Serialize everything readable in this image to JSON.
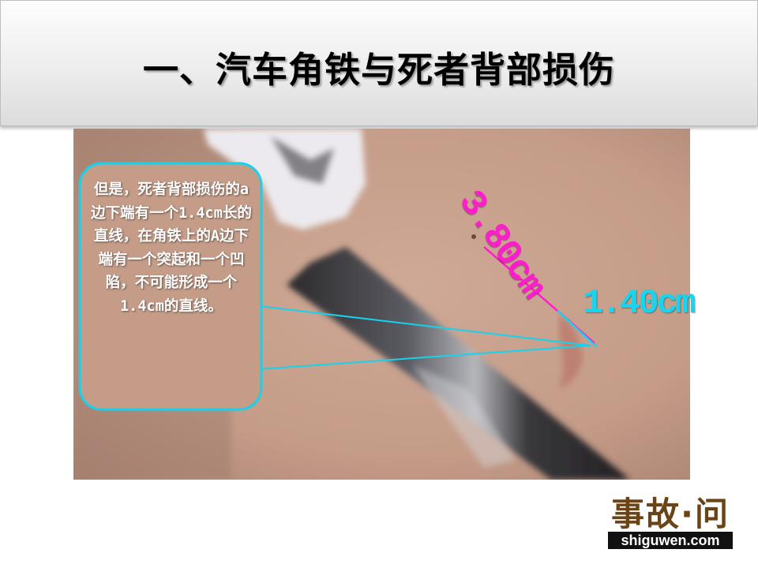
{
  "slide": {
    "title": "一、汽车角铁与死者背部损伤"
  },
  "callout": {
    "text": "但是，死者背部损伤的a边下端有一个1.4cm长的直线，在角铁上的A边下端有一个突起和一个凹陷，不可能形成一个1.4cm的直线。"
  },
  "measurements": {
    "long_edge": "3.80cm",
    "short_edge": "1.40cm"
  },
  "logo": {
    "chinese": "事故·问",
    "domain": "shiguwen.com"
  },
  "colors": {
    "callout_border": "#16d2ec",
    "long_edge_mark": "#ff1ecc",
    "short_edge_mark": "#18d5ef",
    "skin": "#c8a08c"
  }
}
